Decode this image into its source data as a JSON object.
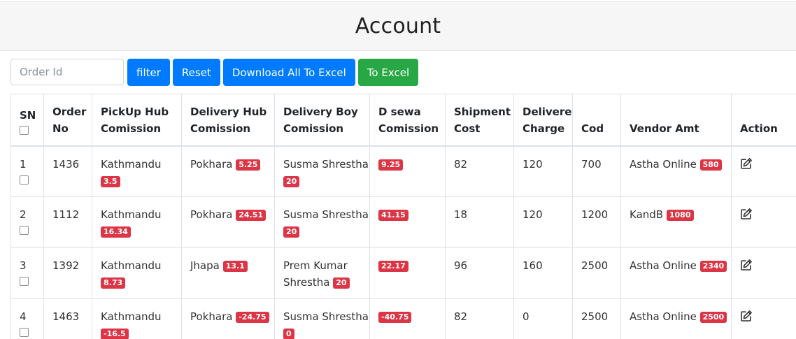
{
  "page": {
    "title": "Account"
  },
  "toolbar": {
    "order_placeholder": "Order Id",
    "filter_label": "filter",
    "reset_label": "Reset",
    "download_all_label": "Download All To Excel",
    "to_excel_label": "To Excel"
  },
  "table": {
    "headers": {
      "sn": "SN",
      "order_no": "Order No",
      "pickup": "PickUp Hub Comission",
      "delivery_hub": "Delivery Hub Comission",
      "delivery_boy": "Delivery Boy Comission",
      "dsewa": "D sewa Comission",
      "shipment": "Shipment Cost",
      "delivere": "Delivere Charge",
      "cod": "Cod",
      "vendor": "Vendor Amt",
      "action": "Action"
    },
    "rows": [
      {
        "sn": "1",
        "order_no": "1436",
        "pickup_name": "Kathmandu",
        "pickup_amt": "3.5",
        "dhub_name": "Pokhara",
        "dhub_amt": "5.25",
        "dboy_name": "Susma Shrestha",
        "dboy_amt": "20",
        "dsewa_amt": "9.25",
        "shipment": "82",
        "delivere": "120",
        "cod": "700",
        "vendor_name": "Astha Online",
        "vendor_amt": "580"
      },
      {
        "sn": "2",
        "order_no": "1112",
        "pickup_name": "Kathmandu",
        "pickup_amt": "16.34",
        "dhub_name": "Pokhara",
        "dhub_amt": "24.51",
        "dboy_name": "Susma Shrestha",
        "dboy_amt": "20",
        "dsewa_amt": "41.15",
        "shipment": "18",
        "delivere": "120",
        "cod": "1200",
        "vendor_name": "KandB",
        "vendor_amt": "1080"
      },
      {
        "sn": "3",
        "order_no": "1392",
        "pickup_name": "Kathmandu",
        "pickup_amt": "8.73",
        "dhub_name": "Jhapa",
        "dhub_amt": "13.1",
        "dboy_name": "Prem Kumar Shrestha",
        "dboy_amt": "20",
        "dsewa_amt": "22.17",
        "shipment": "96",
        "delivere": "160",
        "cod": "2500",
        "vendor_name": "Astha Online",
        "vendor_amt": "2340"
      },
      {
        "sn": "4",
        "order_no": "1463",
        "pickup_name": "Kathmandu",
        "pickup_amt": "-16.5",
        "dhub_name": "Pokhara",
        "dhub_amt": "-24.75",
        "dboy_name": "Susma Shrestha",
        "dboy_amt": "0",
        "dsewa_amt": "-40.75",
        "shipment": "82",
        "delivere": "0",
        "cod": "2500",
        "vendor_name": "Astha Online",
        "vendor_amt": "2500"
      }
    ]
  },
  "icons": {
    "edit": "edit-icon",
    "checkbox": "checkbox"
  },
  "colors": {
    "primary": "#007bff",
    "success": "#28a745",
    "danger": "#dc3545"
  }
}
